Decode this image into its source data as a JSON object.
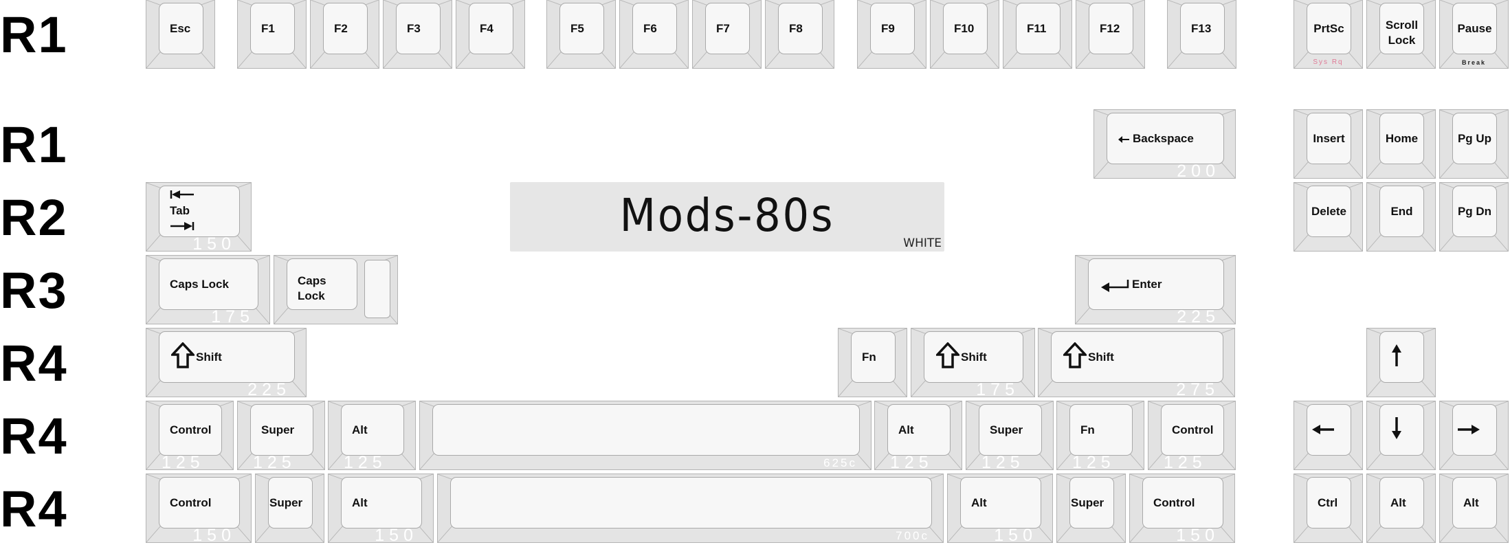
{
  "row_labels": [
    "R1",
    "R1",
    "R2",
    "R3",
    "R4",
    "R4",
    "R4"
  ],
  "badge": {
    "title": "Mods-80s",
    "variant": "WHITE"
  },
  "colors": {
    "key_side": "#e4e4e4",
    "key_top": "#f7f7f7",
    "key_border": "#b4b4b4",
    "size_text": "#ffffff",
    "sysrq_text": "#e07a96",
    "badge_bg": "#e6e6e6"
  },
  "keys": [
    {
      "id": "esc",
      "label": "Esc",
      "size": ""
    },
    {
      "id": "f1",
      "label": "F1",
      "size": ""
    },
    {
      "id": "f2",
      "label": "F2",
      "size": ""
    },
    {
      "id": "f3",
      "label": "F3",
      "size": ""
    },
    {
      "id": "f4",
      "label": "F4",
      "size": ""
    },
    {
      "id": "f5",
      "label": "F5",
      "size": ""
    },
    {
      "id": "f6",
      "label": "F6",
      "size": ""
    },
    {
      "id": "f7",
      "label": "F7",
      "size": ""
    },
    {
      "id": "f8",
      "label": "F8",
      "size": ""
    },
    {
      "id": "f9",
      "label": "F9",
      "size": ""
    },
    {
      "id": "f10",
      "label": "F10",
      "size": ""
    },
    {
      "id": "f11",
      "label": "F11",
      "size": ""
    },
    {
      "id": "f12",
      "label": "F12",
      "size": ""
    },
    {
      "id": "f13",
      "label": "F13",
      "size": ""
    },
    {
      "id": "prtsc",
      "label": "PrtSc",
      "sublabel": "Sys Rq",
      "size": ""
    },
    {
      "id": "scroll-lock",
      "label": "Scroll\nLock",
      "size": ""
    },
    {
      "id": "pause",
      "label": "Pause",
      "sublabel": "Break",
      "size": ""
    },
    {
      "id": "backspace",
      "label": "Backspace",
      "icon": "arrow-left",
      "size": "200"
    },
    {
      "id": "insert",
      "label": "Insert",
      "size": ""
    },
    {
      "id": "home",
      "label": "Home",
      "size": ""
    },
    {
      "id": "pgup",
      "label": "Pg Up",
      "size": ""
    },
    {
      "id": "tab",
      "label": "Tab",
      "icon": "tab-arrows",
      "size": "150"
    },
    {
      "id": "delete",
      "label": "Delete",
      "size": ""
    },
    {
      "id": "end",
      "label": "End",
      "size": ""
    },
    {
      "id": "pgdn",
      "label": "Pg Dn",
      "size": ""
    },
    {
      "id": "caps-lock",
      "label": "Caps Lock",
      "size": "175"
    },
    {
      "id": "caps-lock-stepped",
      "label": "Caps\nLock",
      "size": ""
    },
    {
      "id": "enter",
      "label": "Enter",
      "icon": "return-arrow",
      "size": "225"
    },
    {
      "id": "left-shift",
      "label": "Shift",
      "icon": "shift-arrow",
      "size": "225"
    },
    {
      "id": "fn-1u",
      "label": "Fn",
      "size": ""
    },
    {
      "id": "right-shift-175",
      "label": "Shift",
      "icon": "shift-arrow",
      "size": "175"
    },
    {
      "id": "right-shift-275",
      "label": "Shift",
      "icon": "shift-arrow",
      "size": "275"
    },
    {
      "id": "up",
      "label": "",
      "icon": "arrow-up",
      "size": ""
    },
    {
      "id": "ctrl-125-l",
      "label": "Control",
      "size": "125"
    },
    {
      "id": "super-125-l",
      "label": "Super",
      "size": "125"
    },
    {
      "id": "alt-125-l",
      "label": "Alt",
      "size": "125"
    },
    {
      "id": "space-625",
      "label": "",
      "size": "625c"
    },
    {
      "id": "alt-125-r",
      "label": "Alt",
      "size": "125"
    },
    {
      "id": "super-125-r",
      "label": "Super",
      "size": "125"
    },
    {
      "id": "fn-125",
      "label": "Fn",
      "size": "125"
    },
    {
      "id": "ctrl-125-r",
      "label": "Control",
      "size": "125"
    },
    {
      "id": "left",
      "label": "",
      "icon": "arrow-left-bold",
      "size": ""
    },
    {
      "id": "down",
      "label": "",
      "icon": "arrow-down",
      "size": ""
    },
    {
      "id": "right",
      "label": "",
      "icon": "arrow-right",
      "size": ""
    },
    {
      "id": "ctrl-150-l",
      "label": "Control",
      "size": "150"
    },
    {
      "id": "super-100-l",
      "label": "Super",
      "size": ""
    },
    {
      "id": "alt-150-l",
      "label": "Alt",
      "size": "150"
    },
    {
      "id": "space-700",
      "label": "",
      "size": "700c"
    },
    {
      "id": "alt-150-r",
      "label": "Alt",
      "size": "150"
    },
    {
      "id": "super-100-r",
      "label": "Super",
      "size": ""
    },
    {
      "id": "ctrl-150-r",
      "label": "Control",
      "size": "150"
    },
    {
      "id": "ctrl-1u",
      "label": "Ctrl",
      "size": ""
    },
    {
      "id": "alt-1u-a",
      "label": "Alt",
      "size": ""
    },
    {
      "id": "alt-1u-b",
      "label": "Alt",
      "size": ""
    }
  ]
}
